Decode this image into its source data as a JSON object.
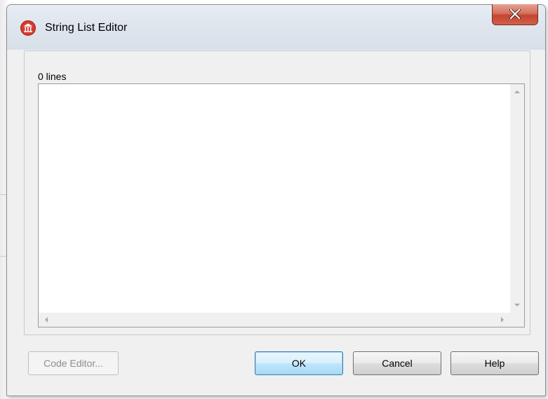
{
  "window": {
    "title": "String List Editor",
    "close_symbol": "✕"
  },
  "editor": {
    "line_count_label": "0 lines",
    "content": ""
  },
  "buttons": {
    "code_editor": "Code Editor...",
    "ok": "OK",
    "cancel": "Cancel",
    "help": "Help"
  },
  "icons": {
    "app": "app-shield-icon",
    "close": "close-icon",
    "scroll_up": "scroll-up-arrow-icon",
    "scroll_down": "scroll-down-arrow-icon",
    "scroll_left": "scroll-left-arrow-icon",
    "scroll_right": "scroll-right-arrow-icon"
  },
  "colors": {
    "app_icon_red": "#d9372e",
    "close_button_red": "#c5442f",
    "default_button_blue": "#3c7fb1"
  }
}
